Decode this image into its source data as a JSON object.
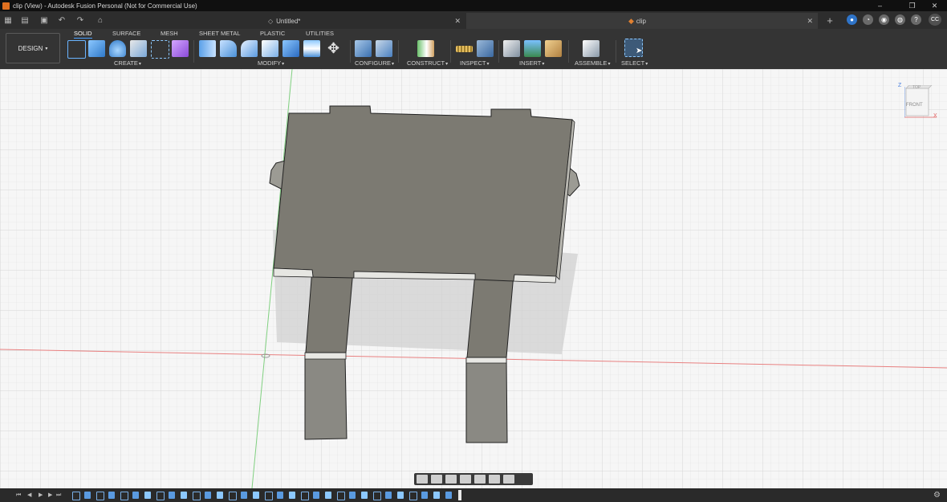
{
  "window": {
    "title": "clip (View) - Autodesk Fusion Personal (Not for Commercial Use)",
    "controls": [
      "minimize",
      "restore",
      "close"
    ]
  },
  "tabs": [
    {
      "label": "Untitled*",
      "active": false
    },
    {
      "label": "clip",
      "active": true
    }
  ],
  "user_initials": "CC",
  "workspace": {
    "label": "DESIGN"
  },
  "toolbar_tabs": [
    "SOLID",
    "SURFACE",
    "MESH",
    "SHEET METAL",
    "PLASTIC",
    "UTILITIES"
  ],
  "active_toolbar_tab": "SOLID",
  "groups": {
    "create": "CREATE",
    "modify": "MODIFY",
    "configure": "CONFIGURE",
    "construct": "CONSTRUCT",
    "inspect": "INSPECT",
    "insert": "INSERT",
    "assemble": "ASSEMBLE",
    "select": "SELECT"
  },
  "viewcube": {
    "top_label": "TOP",
    "front_label": "FRONT",
    "axis_z": "Z",
    "axis_x": "X"
  },
  "colors": {
    "accent": "#4aa0ff",
    "model_face": "#7c7a72",
    "model_side": "#9c9b94",
    "grid": "#dcdcdc",
    "axis_x": "#e06060",
    "axis_y": "#60c060"
  }
}
